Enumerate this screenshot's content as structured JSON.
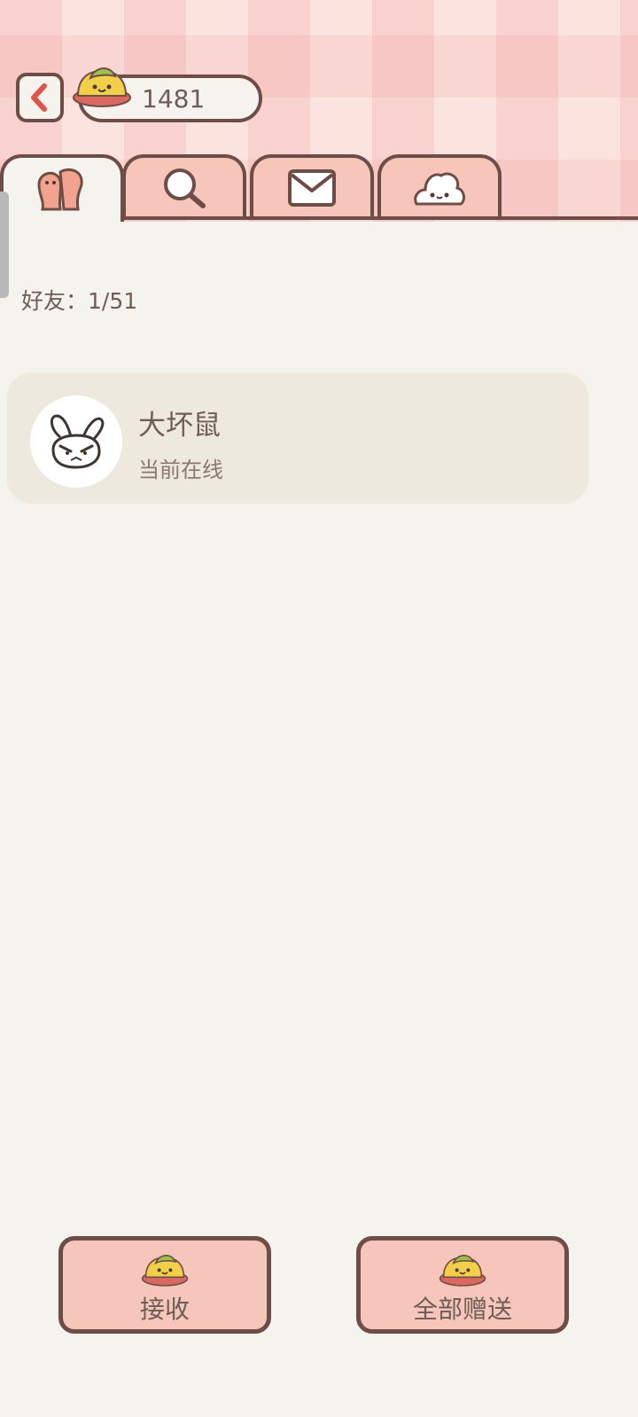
{
  "header": {
    "coin_count": "1481",
    "icons": {
      "back": "chevron-left-icon",
      "currency": "jelly-currency-icon"
    }
  },
  "tabs": [
    {
      "id": "friends",
      "icon": "friends-icon",
      "active": true
    },
    {
      "id": "search",
      "icon": "search-icon",
      "active": false
    },
    {
      "id": "mail",
      "icon": "mail-icon",
      "active": false
    },
    {
      "id": "pet",
      "icon": "cloud-pet-icon",
      "active": false
    }
  ],
  "friends": {
    "count_label": "好友：1/51",
    "list": [
      {
        "name": "大坏鼠",
        "status": "当前在线",
        "avatar_icon": "angry-rabbit-icon"
      }
    ]
  },
  "actions": {
    "receive_label": "接收",
    "gift_all_label": "全部赠送"
  },
  "colors": {
    "header_pink": "#fadcd6",
    "tab_pink": "#f7c6bb",
    "outline_brown": "#6e4d46",
    "background": "#f5f3ee",
    "card": "#ede9df",
    "text": "#6e5d55",
    "accent_red": "#e0524a"
  }
}
